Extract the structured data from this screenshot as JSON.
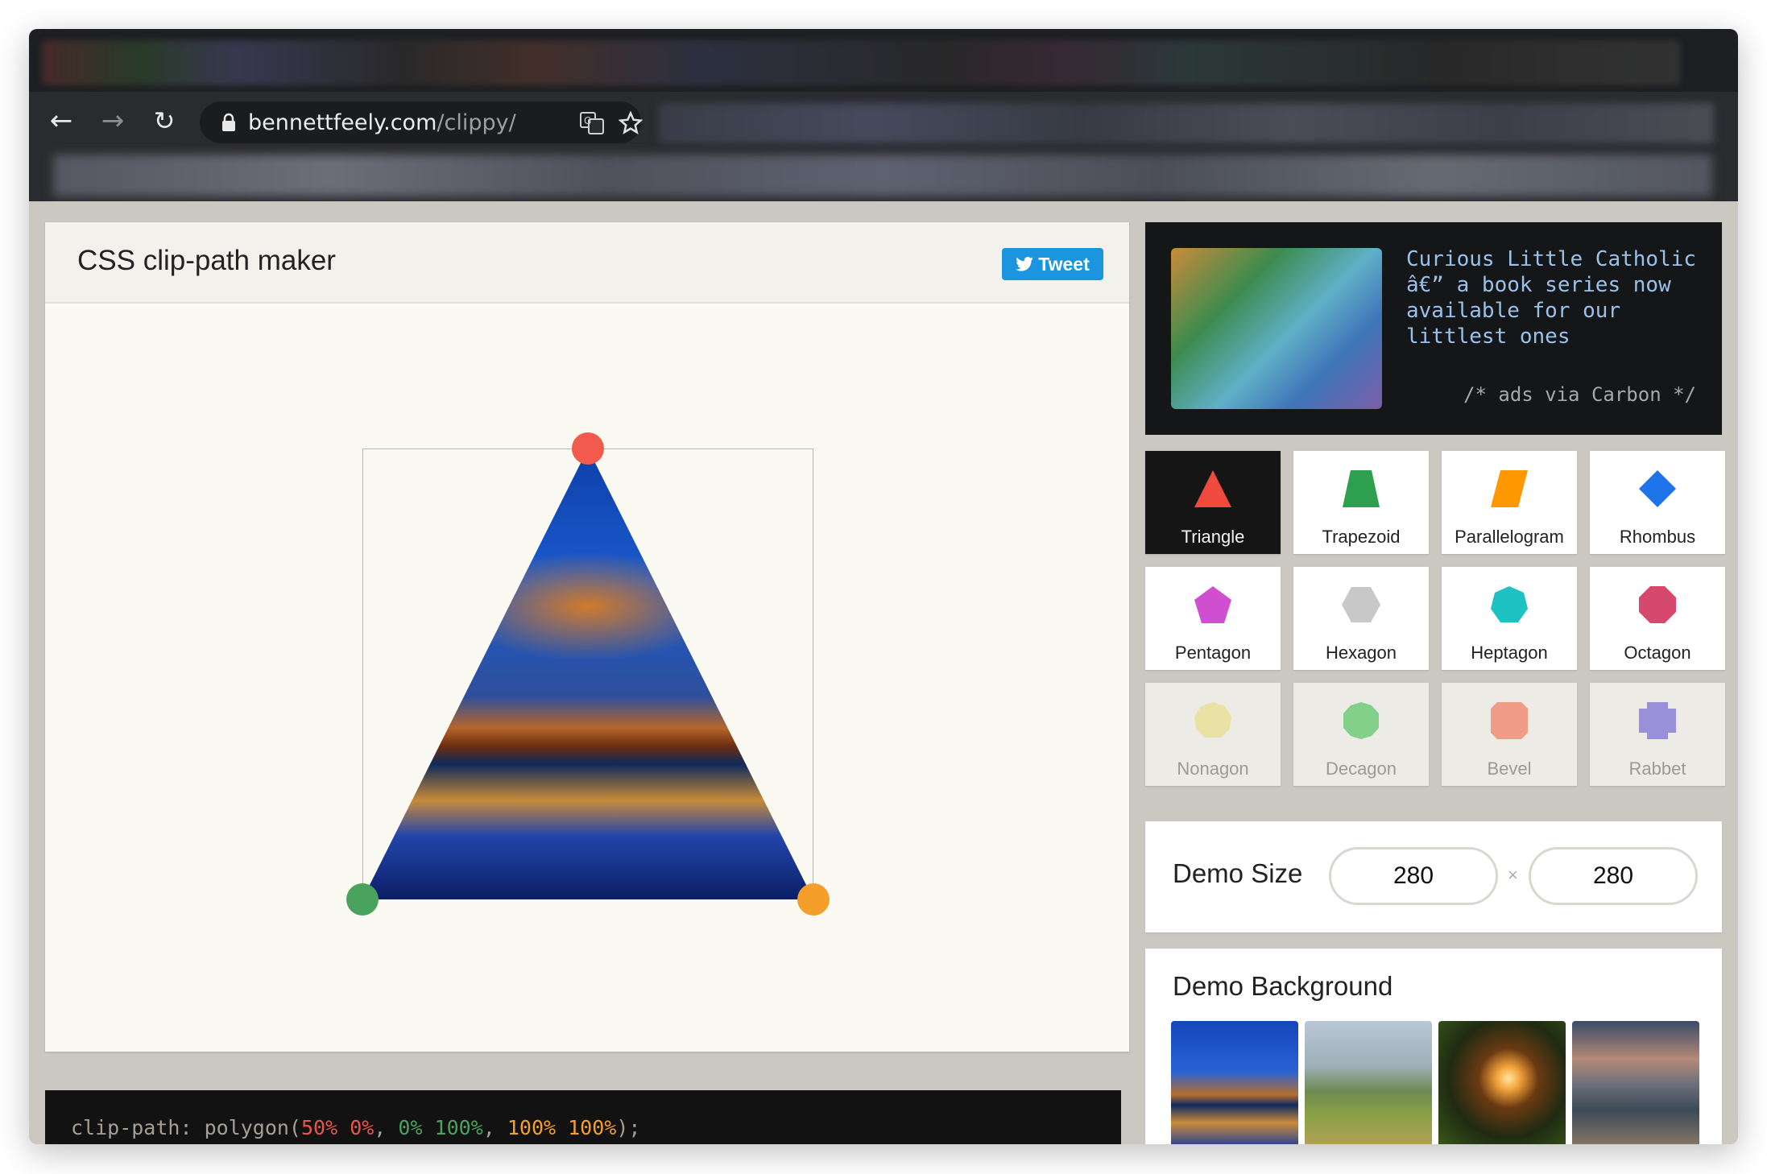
{
  "browser": {
    "url_domain": "bennettfeely.com",
    "url_path": "/clippy/"
  },
  "maker": {
    "title": "CSS clip-path maker",
    "tweet_label": "Tweet"
  },
  "code": {
    "prefix": "clip-path: polygon(",
    "p1": "50% 0%",
    "p2": "0% 100%",
    "p3": "100% 100%",
    "suffix": ");",
    "sep": ", "
  },
  "ad": {
    "text": "Curious Little Catholic â€” a book series now available for our littlest ones",
    "via": "/* ads via Carbon */"
  },
  "shapes": [
    {
      "label": "Triangle",
      "color": "#f04a3e",
      "active": true
    },
    {
      "label": "Trapezoid",
      "color": "#2e9e4f"
    },
    {
      "label": "Parallelogram",
      "color": "#ff9800"
    },
    {
      "label": "Rhombus",
      "color": "#1e73e8"
    },
    {
      "label": "Pentagon",
      "color": "#cf4fd0"
    },
    {
      "label": "Hexagon",
      "color": "#c8c8c8"
    },
    {
      "label": "Heptagon",
      "color": "#1fc2c2"
    },
    {
      "label": "Octagon",
      "color": "#d6486c"
    },
    {
      "label": "Nonagon",
      "color": "#e6de7a"
    },
    {
      "label": "Decagon",
      "color": "#3fbf4f"
    },
    {
      "label": "Bevel",
      "color": "#f46a4a"
    },
    {
      "label": "Rabbet",
      "color": "#6254cf"
    }
  ],
  "demo_size": {
    "label": "Demo Size",
    "width": "280",
    "height": "280",
    "separator": "×"
  },
  "demo_background": {
    "label": "Demo Background"
  },
  "handle_colors": {
    "top": "#f15a4d",
    "left": "#4aa35c",
    "right": "#f59f2b"
  }
}
